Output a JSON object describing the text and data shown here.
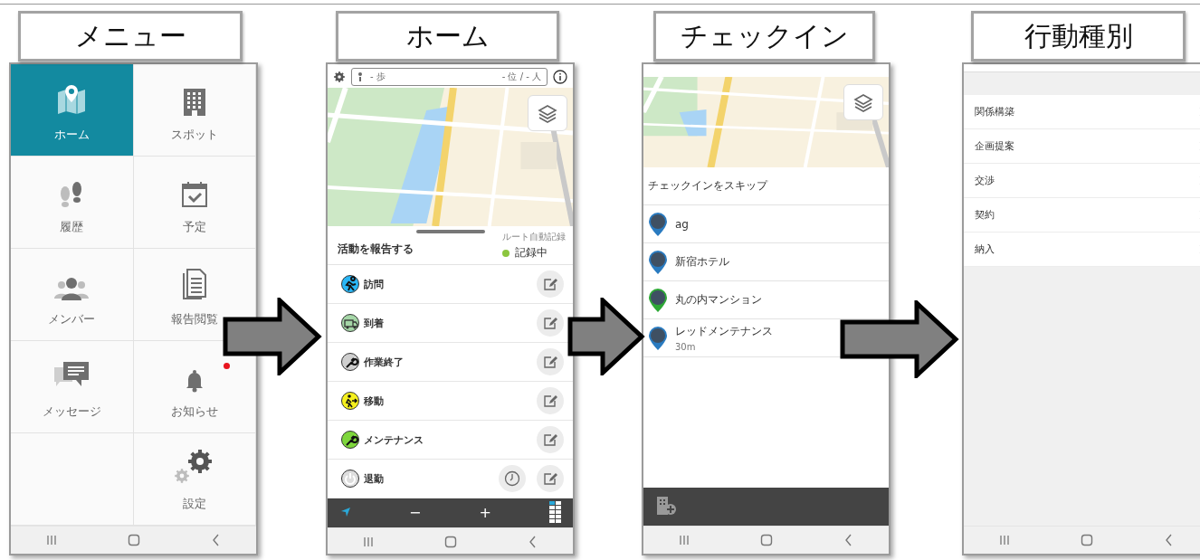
{
  "screens": [
    {
      "kind": "menu",
      "label": "メニュー",
      "tiles": [
        {
          "kind": "tile",
          "label": "ホーム",
          "selected": true,
          "unread": false
        },
        {
          "kind": "tile",
          "label": "スポット",
          "selected": false,
          "unread": false
        },
        {
          "kind": "tile",
          "label": "履歴",
          "selected": false,
          "unread": false
        },
        {
          "kind": "tile",
          "label": "予定",
          "selected": false,
          "unread": false
        },
        {
          "kind": "tile",
          "label": "メンバー",
          "selected": false,
          "unread": false
        },
        {
          "kind": "tile",
          "label": "報告閲覧",
          "selected": false,
          "unread": false
        },
        {
          "kind": "tile",
          "label": "メッセージ",
          "selected": false,
          "unread": false
        },
        {
          "kind": "tile",
          "label": "お知らせ",
          "selected": false,
          "unread": true
        },
        {
          "kind": "blank"
        },
        {
          "kind": "tile",
          "label": "設定",
          "selected": false,
          "unread": false
        }
      ]
    },
    {
      "kind": "home",
      "label": "ホーム",
      "steps": "- 歩",
      "rank": "- 位 / - 人",
      "title": "活動を報告する",
      "route_label": "ルート自動記録",
      "route_status": "記録中",
      "recording": true,
      "activities": [
        {
          "label": "訪問",
          "color": "#29b6f6",
          "clock": false
        },
        {
          "label": "到着",
          "color": "#a5d6a7",
          "clock": false
        },
        {
          "label": "作業終了",
          "color": "#cfcfcf",
          "clock": false
        },
        {
          "label": "移動",
          "color": "#f5f01e",
          "clock": false
        },
        {
          "label": "メンテナンス",
          "color": "#7ed63c",
          "clock": false
        },
        {
          "label": "退勤",
          "color": "#dddddd",
          "clock": true
        }
      ],
      "zoom_out": "−",
      "zoom_in": "+"
    },
    {
      "kind": "checkin",
      "label": "チェックイン",
      "skip": "チェックインをスキップ",
      "spots": [
        {
          "name": "ag",
          "color": "#2a7bc0"
        },
        {
          "name": "新宿ホテル",
          "color": "#2a7bc0"
        },
        {
          "name": "丸の内マンション",
          "color": "#2ea836"
        },
        {
          "name": "レッドメンテナンス",
          "color": "#2a7bc0",
          "distance": "30m"
        }
      ]
    },
    {
      "kind": "categories",
      "label": "行動種別",
      "items": [
        "関係構築",
        "企画提案",
        "交渉",
        "契約",
        "納入"
      ]
    }
  ]
}
